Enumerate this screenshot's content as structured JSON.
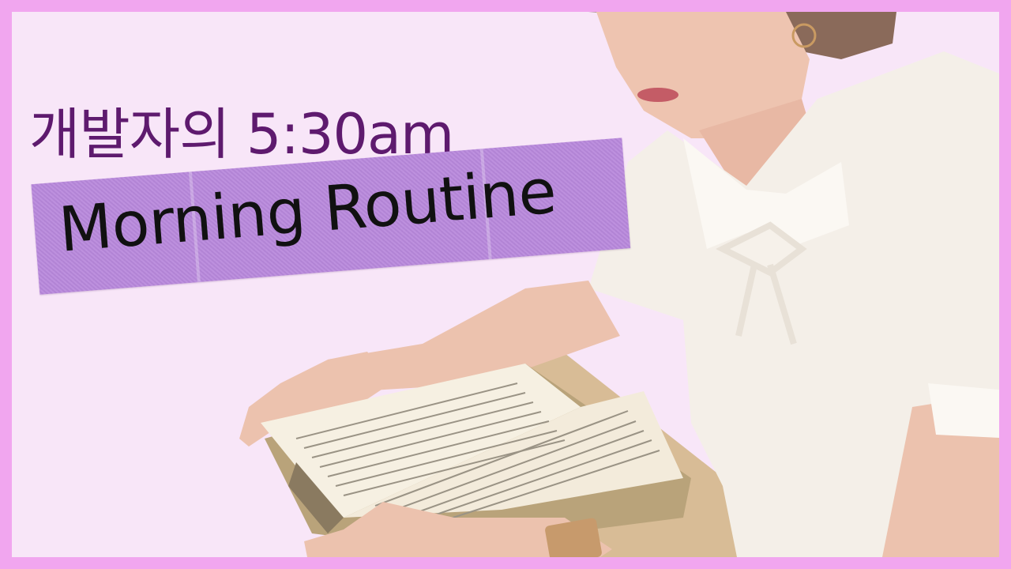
{
  "thumbnail": {
    "title_line1": "개발자의 5:30am",
    "title_line2": "Morning Routine",
    "colors": {
      "border": "#f1a6ef",
      "background": "#f8e6f8",
      "title_line1_color": "#5e1a6e",
      "tape": "#b888dc",
      "title_line2_color": "#111111"
    }
  }
}
